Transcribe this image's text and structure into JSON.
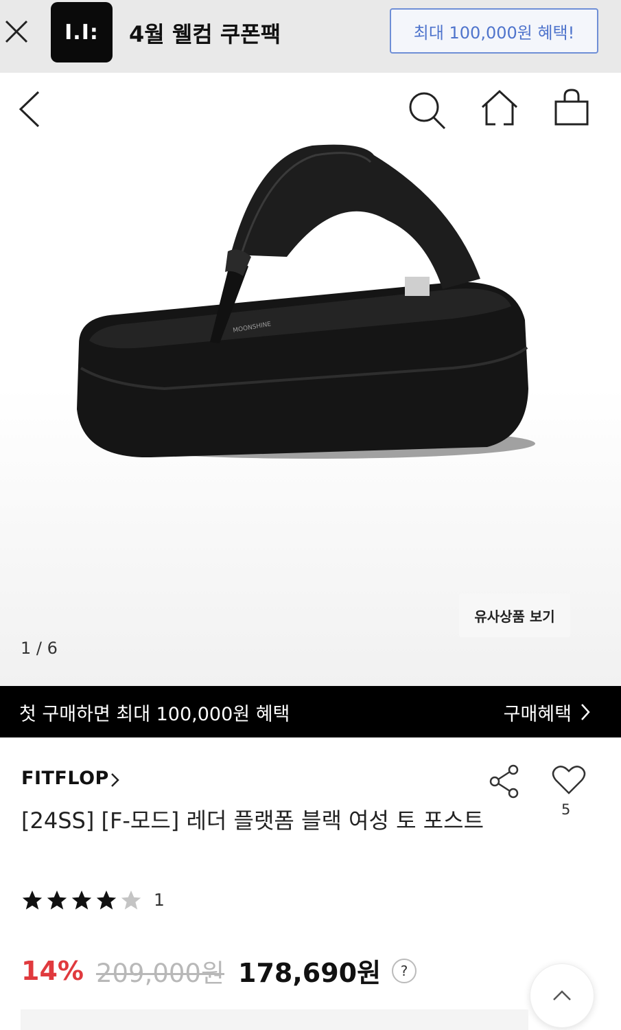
{
  "promo": {
    "logo_text": "I.I:",
    "title": "4월 웰컴 쿠폰팩",
    "cta": "최대 100,000원 혜택!"
  },
  "hero": {
    "similar_button": "유사상품 보기",
    "pager": "1 / 6",
    "insole_text": "MOONSHINE"
  },
  "benefit_bar": {
    "text": "첫 구매하면 최대 100,000원 혜택",
    "link": "구매혜택"
  },
  "product": {
    "brand": "FITFLOP",
    "name": "[24SS] [F-모드] 레더 플랫폼 블랙 여성 토 포스트",
    "likes": "5",
    "rating": 4,
    "rating_max": 5,
    "review_count": "1",
    "discount": "14%",
    "original_price": "209,000원",
    "final_price": "178,690원",
    "help_symbol": "?"
  },
  "colors": {
    "discount": "#e03a3e",
    "cta_border": "#6e8ed6",
    "cta_text": "#4f74cc",
    "banner_bg": "#000000"
  }
}
